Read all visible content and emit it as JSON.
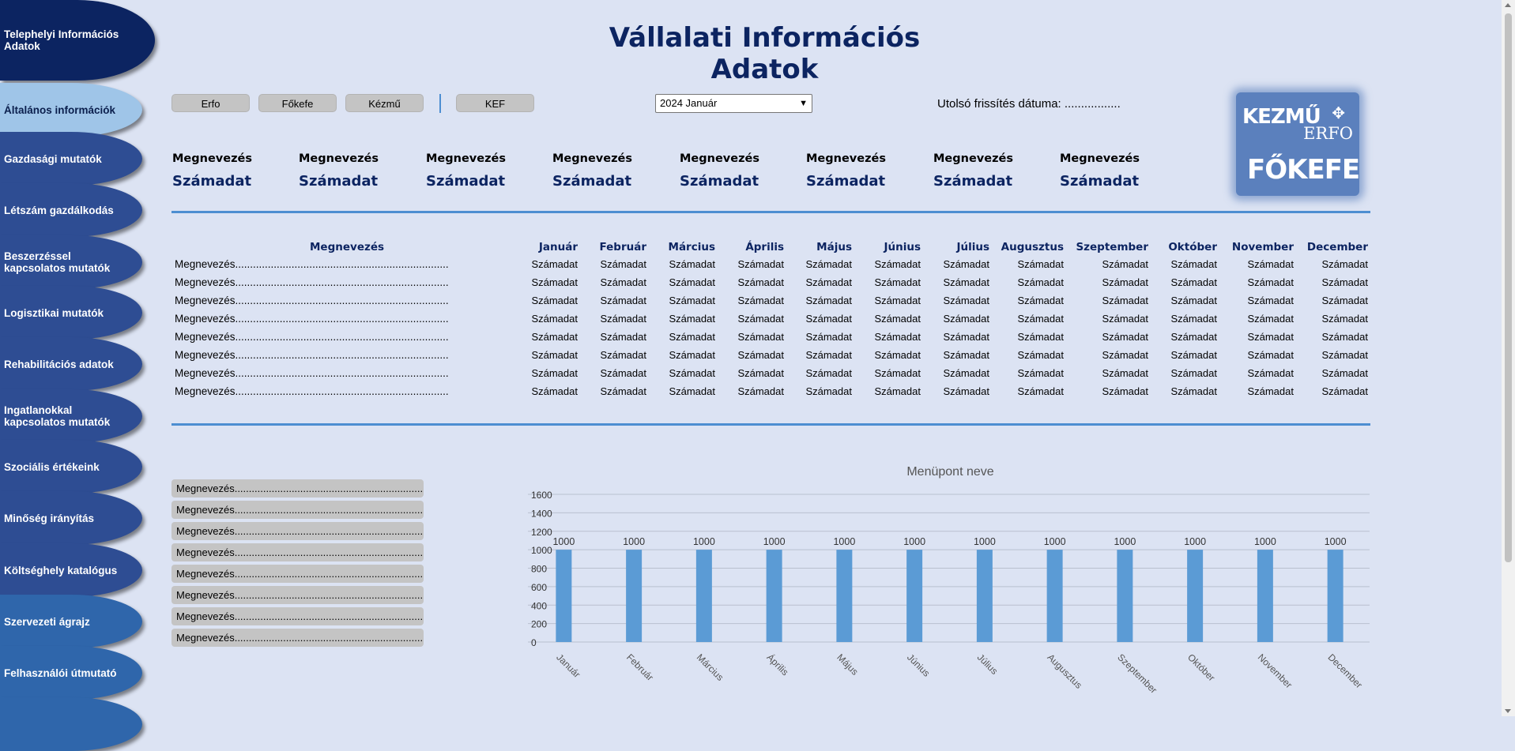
{
  "sidebar": {
    "items": [
      {
        "label": "Telephelyi Információs Adatok"
      },
      {
        "label": "Általános információk"
      },
      {
        "label": "Gazdasági mutatók"
      },
      {
        "label": "Létszám gazdálkodás"
      },
      {
        "label": "Beszerzéssel kapcsolatos mutatók"
      },
      {
        "label": "Logisztikai mutatók"
      },
      {
        "label": "Rehabilitációs adatok"
      },
      {
        "label": "Ingatlanokkal kapcsolatos mutatók"
      },
      {
        "label": "Szociális értékeink"
      },
      {
        "label": "Minőség irányítás"
      },
      {
        "label": "Költséghely katalógus"
      },
      {
        "label": "Szervezeti ágrajz"
      },
      {
        "label": "Felhasználói útmutató"
      },
      {
        "label": ""
      }
    ]
  },
  "header": {
    "title": "Vállalati Információs Adatok",
    "buttons": [
      "Erfo",
      "Főkefe",
      "Kézmű",
      "KEF"
    ],
    "period_select": "2024 Január",
    "last_update": "Utolsó frissítés dátuma: ................."
  },
  "logo": {
    "kezmu": "KEZMŰ",
    "erfo": "ERFO",
    "fokefe": "FŐKEFE"
  },
  "kpis": [
    {
      "label": "Megnevezés",
      "value": "Számadat"
    },
    {
      "label": "Megnevezés",
      "value": "Számadat"
    },
    {
      "label": "Megnevezés",
      "value": "Számadat"
    },
    {
      "label": "Megnevezés",
      "value": "Számadat"
    },
    {
      "label": "Megnevezés",
      "value": "Számadat"
    },
    {
      "label": "Megnevezés",
      "value": "Számadat"
    },
    {
      "label": "Megnevezés",
      "value": "Számadat"
    },
    {
      "label": "Megnevezés",
      "value": "Számadat"
    }
  ],
  "table": {
    "header_label": "Megnevezés",
    "months": [
      "Január",
      "Február",
      "Március",
      "Április",
      "Május",
      "Június",
      "Július",
      "Augusztus",
      "Szeptember",
      "Október",
      "November",
      "December"
    ],
    "row_label": "Megnevezés........................................................................",
    "cell_value": "Számadat",
    "row_count": 8
  },
  "list": {
    "items": [
      "Megnevezés.......................................................................",
      "Megnevezés.......................................................................",
      "Megnevezés.......................................................................",
      "Megnevezés.......................................................................",
      "Megnevezés.......................................................................",
      "Megnevezés.......................................................................",
      "Megnevezés.......................................................................",
      "Megnevezés......................................................................."
    ]
  },
  "chart_data": {
    "type": "bar",
    "title": "Menüpont neve",
    "categories": [
      "Január",
      "Február",
      "Március",
      "Április",
      "Május",
      "Június",
      "Július",
      "Augusztus",
      "Szeptember",
      "Október",
      "November",
      "December"
    ],
    "values": [
      1000,
      1000,
      1000,
      1000,
      1000,
      1000,
      1000,
      1000,
      1000,
      1000,
      1000,
      1000
    ],
    "ylim": [
      0,
      1600
    ],
    "yticks": [
      0,
      200,
      400,
      600,
      800,
      1000,
      1200,
      1400,
      1600
    ],
    "grid": true,
    "color": "#5b9bd5"
  }
}
